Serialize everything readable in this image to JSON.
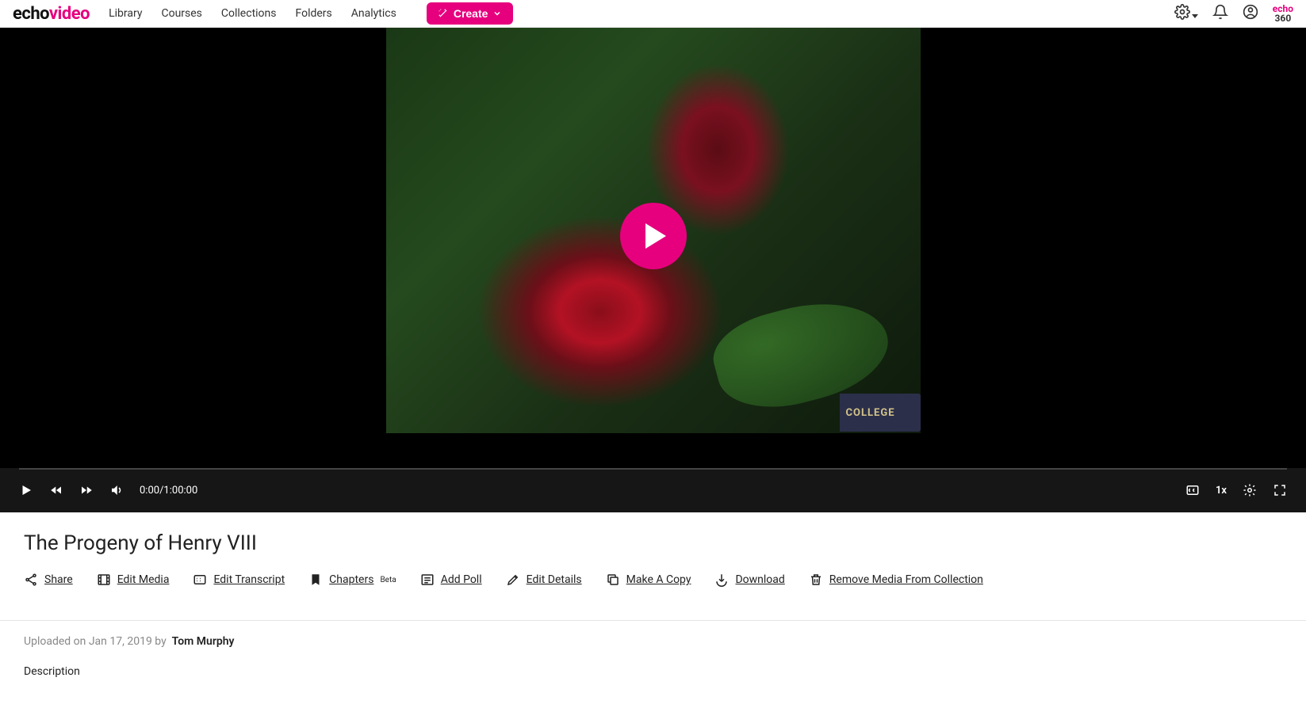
{
  "brand": {
    "part1": "echo",
    "part2": "video"
  },
  "nav": {
    "library": "Library",
    "courses": "Courses",
    "collections": "Collections",
    "folders": "Folders",
    "analytics": "Analytics",
    "create": "Create"
  },
  "smallLogo": {
    "line1": "echo",
    "line2": "360"
  },
  "video": {
    "watermark": "COLLEGE"
  },
  "player": {
    "time": "0:00/1:00:00",
    "speed": "1x"
  },
  "title": "The Progeny of Henry VIII",
  "actions": {
    "share": "Share",
    "editMedia": "Edit Media",
    "editTranscript": "Edit Transcript",
    "chapters": "Chapters",
    "chaptersBadge": "Beta",
    "addPoll": "Add Poll",
    "editDetails": "Edit Details",
    "makeCopy": "Make A Copy",
    "download": "Download",
    "remove": "Remove Media From Collection"
  },
  "meta": {
    "uploadedPrefix": "Uploaded on ",
    "uploadedDate": "Jan 17, 2019",
    "by": " by ",
    "author": "Tom Murphy",
    "descriptionLabel": "Description"
  }
}
